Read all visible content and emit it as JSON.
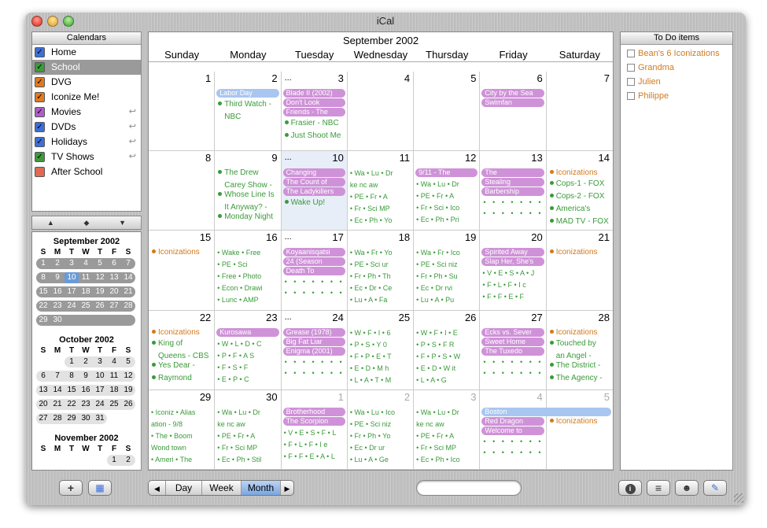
{
  "window": {
    "title": "iCal"
  },
  "calendars": {
    "header": "Calendars",
    "items": [
      {
        "label": "Home",
        "color": "#3c6fd8",
        "checked": true,
        "arrow": false,
        "selected": false
      },
      {
        "label": "School",
        "color": "#3c9a3c",
        "checked": true,
        "arrow": false,
        "selected": true
      },
      {
        "label": "DVG",
        "color": "#e07a20",
        "checked": true,
        "arrow": false,
        "selected": false
      },
      {
        "label": "Iconize Me!",
        "color": "#e07a20",
        "checked": true,
        "arrow": false,
        "selected": false
      },
      {
        "label": "Movies",
        "color": "#b05cc8",
        "checked": true,
        "arrow": true,
        "selected": false
      },
      {
        "label": "DVDs",
        "color": "#3c6fd8",
        "checked": true,
        "arrow": true,
        "selected": false
      },
      {
        "label": "Holidays",
        "color": "#3c6fd8",
        "checked": true,
        "arrow": true,
        "selected": false
      },
      {
        "label": "TV Shows",
        "color": "#3c9a3c",
        "checked": true,
        "arrow": true,
        "selected": false
      },
      {
        "label": "After School",
        "color": "#e06a50",
        "checked": false,
        "arrow": false,
        "selected": false
      }
    ]
  },
  "mini_nav": {
    "prev": "▲",
    "today": "◆",
    "next": "▼"
  },
  "mini_months": [
    {
      "title": "September 2002",
      "headers": [
        "S",
        "M",
        "T",
        "W",
        "T",
        "F",
        "S"
      ],
      "first_col": 0,
      "days": 30,
      "today": 10
    },
    {
      "title": "October 2002",
      "headers": [
        "S",
        "M",
        "T",
        "W",
        "T",
        "F",
        "S"
      ],
      "first_col": 2,
      "days": 31,
      "today": null
    },
    {
      "title": "November 2002",
      "headers": [
        "S",
        "M",
        "T",
        "W",
        "T",
        "F",
        "S"
      ],
      "first_col": 5,
      "days": 30,
      "today": null
    }
  ],
  "month": {
    "title": "September 2002",
    "day_names": [
      "Sunday",
      "Monday",
      "Tuesday",
      "Wednesday",
      "Thursday",
      "Friday",
      "Saturday"
    ],
    "weeks": [
      [
        {
          "n": "1"
        },
        {
          "n": "2"
        },
        {
          "n": "3",
          "dots": "..."
        },
        {
          "n": "4"
        },
        {
          "n": "5"
        },
        {
          "n": "6"
        },
        {
          "n": "7"
        }
      ],
      [
        {
          "n": "8"
        },
        {
          "n": "9"
        },
        {
          "n": "10",
          "dots": "...",
          "today": true
        },
        {
          "n": "11"
        },
        {
          "n": "12"
        },
        {
          "n": "13"
        },
        {
          "n": "14"
        }
      ],
      [
        {
          "n": "15"
        },
        {
          "n": "16"
        },
        {
          "n": "17",
          "dots": "..."
        },
        {
          "n": "18"
        },
        {
          "n": "19"
        },
        {
          "n": "20"
        },
        {
          "n": "21"
        }
      ],
      [
        {
          "n": "22"
        },
        {
          "n": "23"
        },
        {
          "n": "24",
          "dots": "..."
        },
        {
          "n": "25"
        },
        {
          "n": "26"
        },
        {
          "n": "27"
        },
        {
          "n": "28"
        }
      ],
      [
        {
          "n": "29"
        },
        {
          "n": "30"
        },
        {
          "n": "1",
          "other": true
        },
        {
          "n": "2",
          "other": true
        },
        {
          "n": "3",
          "other": true
        },
        {
          "n": "4",
          "other": true
        },
        {
          "n": "5",
          "other": true
        }
      ]
    ],
    "cell_events": [
      {
        "w": 0,
        "d": 1,
        "bands": [
          {
            "t": "Labor Day",
            "c": "blue"
          }
        ],
        "lines": [
          {
            "t": "Third Watch -",
            "o": false,
            "b": true
          },
          {
            "t": "NBC",
            "o": false,
            "b": false
          }
        ]
      },
      {
        "w": 0,
        "d": 2,
        "bands": [
          {
            "t": "Blade II (2002)",
            "c": "purple"
          },
          {
            "t": "Don't Look",
            "c": "purple"
          },
          {
            "t": "Friends - The",
            "c": "purple"
          }
        ],
        "lines": [
          {
            "t": "Frasier - NBC",
            "o": false,
            "b": true
          },
          {
            "t": "Just Shoot Me",
            "o": false,
            "b": true
          }
        ]
      },
      {
        "w": 0,
        "d": 5,
        "bands": [
          {
            "t": "City by the Sea",
            "c": "purple"
          },
          {
            "t": "Swimfan",
            "c": "purple"
          }
        ],
        "lines": []
      },
      {
        "w": 1,
        "d": 1,
        "bands": [],
        "lines": [
          {
            "t": "The Drew",
            "o": false,
            "b": true
          },
          {
            "t": "Carey Show -",
            "o": false,
            "b": false
          },
          {
            "t": "Whose Line Is",
            "o": false,
            "b": true
          },
          {
            "t": "It Anyway? -",
            "o": false,
            "b": false
          },
          {
            "t": "Monday Night",
            "o": false,
            "b": true
          }
        ]
      },
      {
        "w": 1,
        "d": 2,
        "bands": [
          {
            "t": "Changing",
            "c": "purple"
          },
          {
            "t": "The Count of",
            "c": "purple"
          },
          {
            "t": "The Ladykillers",
            "c": "purple"
          }
        ],
        "lines": [
          {
            "t": "Wake Up!",
            "o": false,
            "b": true
          }
        ]
      },
      {
        "w": 1,
        "d": 3,
        "bands": [],
        "lines": [],
        "grid": [
          "• Wa  • Lu  • Dr",
          "   ke     nc    aw",
          "• PE  • Fr  • A",
          "• Fr  • Sci   MP",
          "• Ec  • Ph  • Yo"
        ]
      },
      {
        "w": 1,
        "d": 4,
        "bands": [
          {
            "t": "9/11 - The",
            "c": "purple"
          }
        ],
        "lines": [],
        "grid": [
          "• Wa  • Lu  • Dr",
          "• PE  • Fr  • A",
          "• Fr  • Sci  • Ico",
          "• Ec  • Ph  • Pri"
        ]
      },
      {
        "w": 1,
        "d": 5,
        "bands": [
          {
            "t": "The",
            "c": "purple"
          },
          {
            "t": "Stealing",
            "c": "purple"
          },
          {
            "t": "Barbership",
            "c": "purple"
          }
        ],
        "lines": [],
        "dotrows": 2
      },
      {
        "w": 1,
        "d": 6,
        "bands": [],
        "lines": [
          {
            "t": "Iconizations",
            "o": true,
            "b": true
          },
          {
            "t": "Cops-1 - FOX",
            "o": false,
            "b": true
          },
          {
            "t": "Cops-2 - FOX",
            "o": false,
            "b": true
          },
          {
            "t": "America's",
            "o": false,
            "b": true
          },
          {
            "t": "MAD TV - FOX",
            "o": false,
            "b": true
          }
        ]
      },
      {
        "w": 2,
        "d": 0,
        "bands": [],
        "lines": [
          {
            "t": "Iconizations",
            "o": true,
            "b": true
          }
        ]
      },
      {
        "w": 2,
        "d": 1,
        "bands": [],
        "lines": [],
        "grid": [
          "• Wake  • Free",
          "• PE     • Sci",
          "• Free  • Photo",
          "• Econ  • Drawi",
          "• Lunc  • AMP"
        ]
      },
      {
        "w": 2,
        "d": 2,
        "bands": [
          {
            "t": "Koyaanisqatsi",
            "c": "purple"
          },
          {
            "t": "24 (Season",
            "c": "purple"
          },
          {
            "t": "Death To",
            "c": "purple"
          }
        ],
        "lines": [],
        "dotrows": 2
      },
      {
        "w": 2,
        "d": 3,
        "bands": [],
        "lines": [],
        "grid": [
          "• Wa  • Fr  • Yo",
          "• PE  • Sci    ur",
          "• Fr  • Ph  • Th",
          "• Ec  • Dr  • Ce",
          "• Lu  • A    • Fa"
        ]
      },
      {
        "w": 2,
        "d": 4,
        "bands": [],
        "lines": [],
        "grid": [
          "• Wa  • Fr  • Ico",
          "• PE  • Sci   niz",
          "• Fr  • Ph  • Su",
          "• Ec  • Dr    rvi",
          "• Lu  • A    • Pu"
        ]
      },
      {
        "w": 2,
        "d": 5,
        "bands": [
          {
            "t": "Spirited Away",
            "c": "purple"
          },
          {
            "t": "Slap Her, She's",
            "c": "purple"
          }
        ],
        "lines": [],
        "grid": [
          "• V • E • S • A • J",
          "• F • L • F • I    c",
          "• F • F • E • F"
        ]
      },
      {
        "w": 2,
        "d": 6,
        "bands": [],
        "lines": [
          {
            "t": "Iconizations",
            "o": true,
            "b": true
          }
        ]
      },
      {
        "w": 3,
        "d": 0,
        "bands": [],
        "lines": [
          {
            "t": "Iconizations",
            "o": true,
            "b": true
          },
          {
            "t": "King of",
            "o": false,
            "b": true
          },
          {
            "t": "Queens - CBS",
            "o": false,
            "b": false
          },
          {
            "t": "Yes Dear -",
            "o": false,
            "b": true
          },
          {
            "t": "Raymond",
            "o": false,
            "b": true
          }
        ]
      },
      {
        "w": 3,
        "d": 1,
        "bands": [
          {
            "t": "Kurosawa",
            "c": "purple"
          }
        ],
        "lines": [],
        "grid": [
          "• W • L • D • C",
          "• P • F • A   S",
          "• F • S • F",
          "• E • P • C"
        ]
      },
      {
        "w": 3,
        "d": 2,
        "bands": [
          {
            "t": "Grease (1978)",
            "c": "purple"
          },
          {
            "t": "Big Fat Liar",
            "c": "purple"
          },
          {
            "t": "Enigma (2001)",
            "c": "purple"
          }
        ],
        "lines": [],
        "dotrows": 2
      },
      {
        "w": 3,
        "d": 3,
        "bands": [],
        "lines": [],
        "grid": [
          "• W • F • I  • 6",
          "• P • S • Y   0",
          "• F • P • E • T",
          "• E • D • M   h",
          "• L • A • T • M"
        ]
      },
      {
        "w": 3,
        "d": 4,
        "bands": [],
        "lines": [],
        "grid": [
          "• W • F • I  • E",
          "• P • S • F   R",
          "• F • P • S • W",
          "• E • D • W   it",
          "• L • A • G"
        ]
      },
      {
        "w": 3,
        "d": 5,
        "bands": [
          {
            "t": "Ecks vs. Sever",
            "c": "purple"
          },
          {
            "t": "Sweet Home",
            "c": "purple"
          },
          {
            "t": "The Tuxedo",
            "c": "purple"
          }
        ],
        "lines": [],
        "dotrows": 2
      },
      {
        "w": 3,
        "d": 6,
        "bands": [],
        "lines": [
          {
            "t": "Iconizations",
            "o": true,
            "b": true
          },
          {
            "t": "Touched by",
            "o": false,
            "b": true
          },
          {
            "t": "an Angel -",
            "o": false,
            "b": false
          },
          {
            "t": "The District -",
            "o": false,
            "b": true
          },
          {
            "t": "The Agency -",
            "o": false,
            "b": true
          }
        ]
      },
      {
        "w": 4,
        "d": 0,
        "bands": [],
        "lines": [],
        "grid": [
          "• Iconiz  • Alias",
          "   ation     - 9/8",
          "• The      • Boom",
          "   Wond      town",
          "• Ameri   • The"
        ]
      },
      {
        "w": 4,
        "d": 1,
        "bands": [],
        "lines": [],
        "grid": [
          "• Wa  • Lu  • Dr",
          "   ke     nc    aw",
          "• PE  • Fr  • A",
          "• Fr  • Sci   MP",
          "• Ec  • Ph  • Stil"
        ]
      },
      {
        "w": 4,
        "d": 2,
        "bands": [
          {
            "t": "Brotherhood",
            "c": "purple"
          },
          {
            "t": "The Scorpion",
            "c": "purple"
          }
        ],
        "lines": [],
        "grid": [
          "• V • E • S • F • L",
          "• F • L • F • I    e",
          "• F • F • E • A • L"
        ]
      },
      {
        "w": 4,
        "d": 3,
        "bands": [],
        "lines": [],
        "grid": [
          "• Wa  • Lu  • Ico",
          "• PE  • Sci   niz",
          "• Fr  • Ph  • Yo",
          "• Ec  • Dr    ur",
          "• Lu  • A    • Ge"
        ]
      },
      {
        "w": 4,
        "d": 4,
        "bands": [],
        "lines": [],
        "grid": [
          "• Wa  • Lu  • Dr",
          "   ke     nc    aw",
          "• PE  • Fr  • A",
          "• Fr  • Sci   MP",
          "• Ec  • Ph  • Ico"
        ]
      },
      {
        "w": 4,
        "d": 5,
        "bands": [
          {
            "t": "Red Dragon",
            "c": "purple"
          },
          {
            "t": "Welcome to",
            "c": "purple"
          }
        ],
        "lines": [],
        "dotrows": 2
      },
      {
        "w": 4,
        "d": 6,
        "bands": [],
        "lines": [
          {
            "t": "Iconizations",
            "o": true,
            "b": true
          }
        ]
      }
    ],
    "spanning": [
      {
        "t": "Boston",
        "w": 4,
        "d": 5,
        "span": 2
      }
    ]
  },
  "todo": {
    "header": "To Do items",
    "items": [
      "Bean's 6 Iconizations",
      "Grandma",
      "Julien",
      "Philippe"
    ]
  },
  "toolbar": {
    "add": "+",
    "view_day": "Day",
    "view_week": "Week",
    "view_month": "Month",
    "prev": "◀",
    "next": "▶",
    "search_placeholder": "",
    "info": "i",
    "list": "≡",
    "person": "☻",
    "pin": "✎",
    "grid": "▦"
  }
}
